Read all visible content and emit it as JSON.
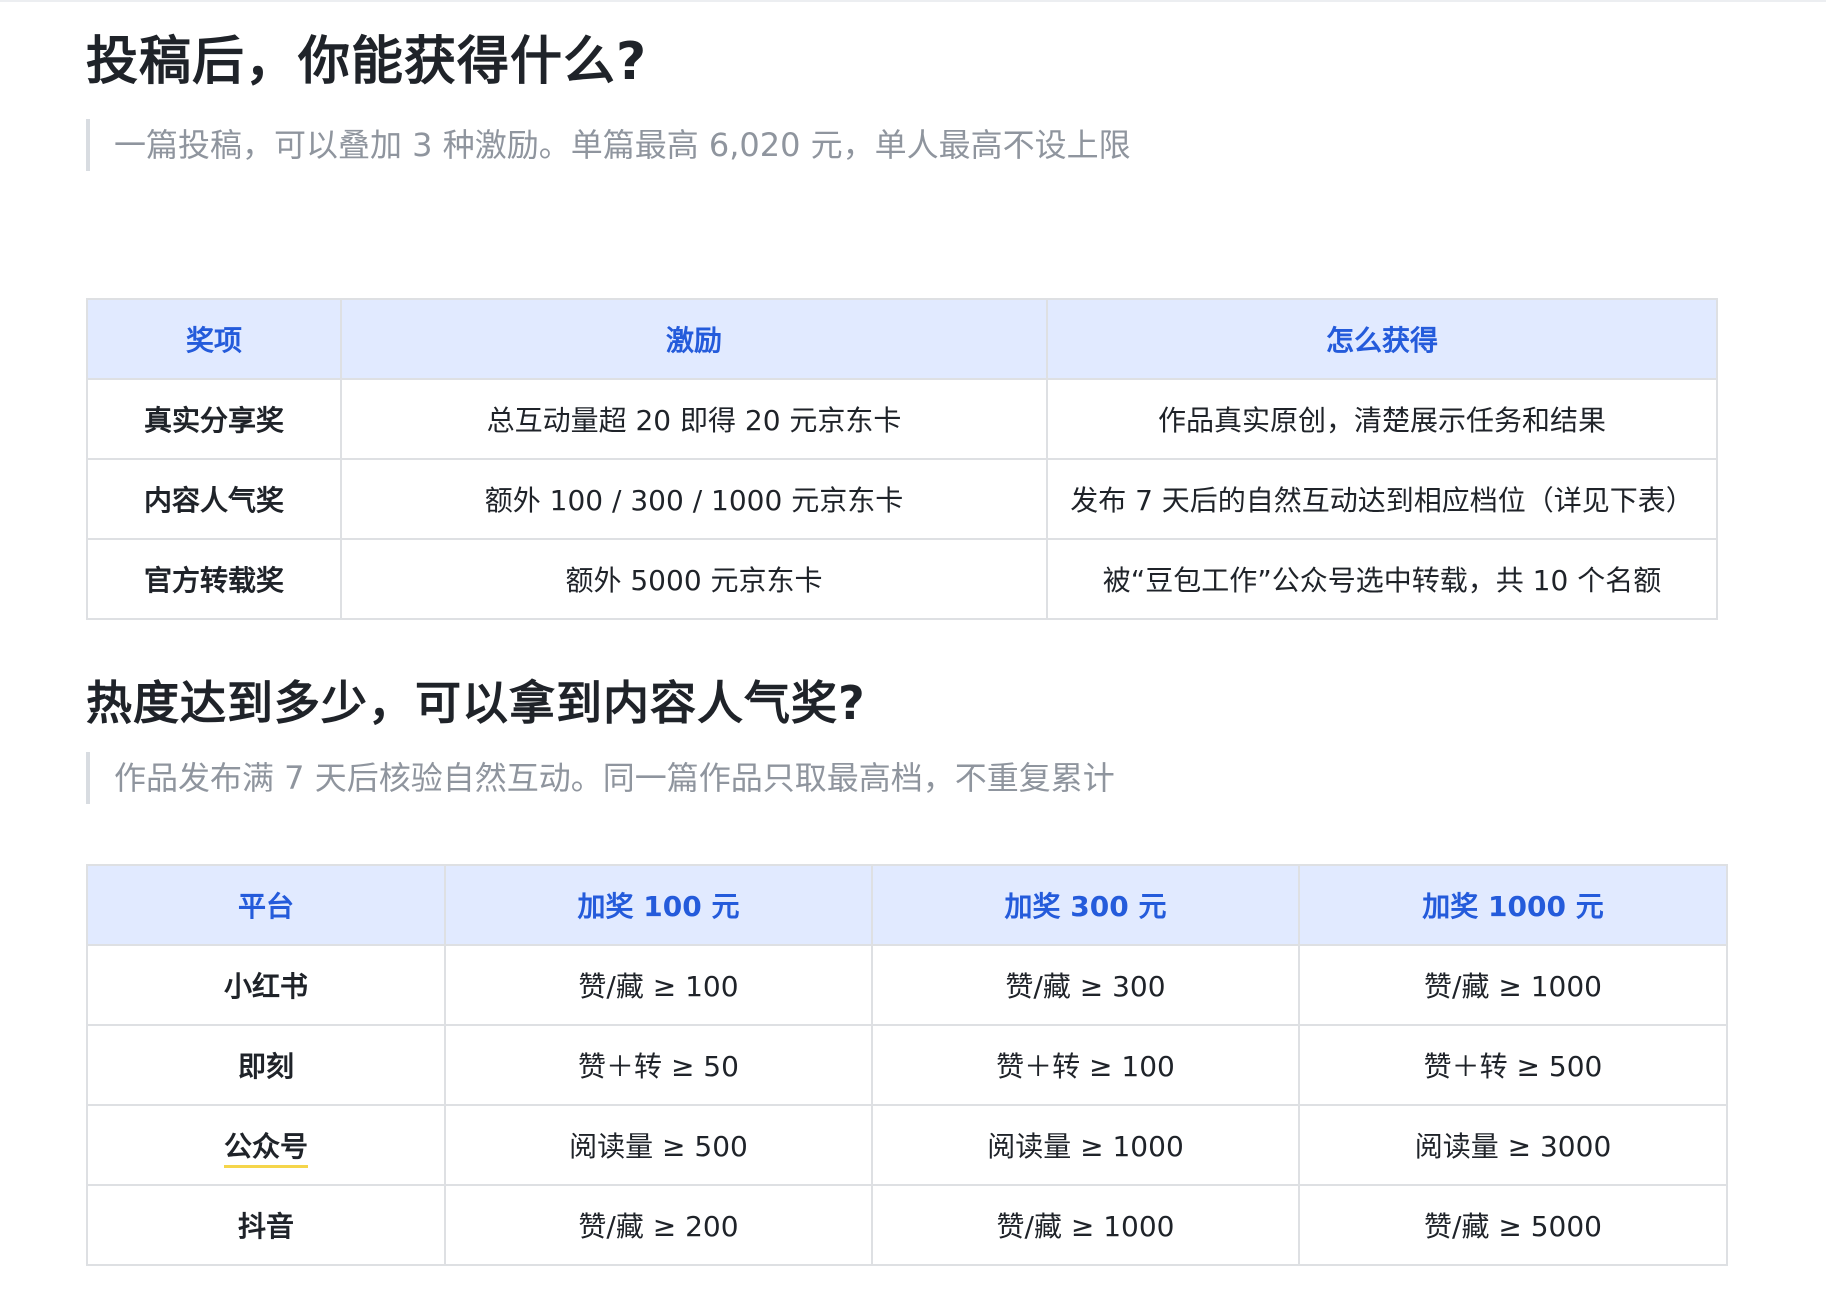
{
  "section1": {
    "title": "投稿后，你能获得什么?",
    "quote": "一篇投稿，可以叠加 3 种激励。单篇最高 6,020 元，单人最高不设上限",
    "table": {
      "headers": [
        "奖项",
        "激励",
        "怎么获得"
      ],
      "rows": [
        [
          "真实分享奖",
          "总互动量超 20 即得 20 元京东卡",
          "作品真实原创，清楚展示任务和结果"
        ],
        [
          "内容人气奖",
          "额外 100 / 300 / 1000 元京东卡",
          "发布 7 天后的自然互动达到相应档位（详见下表）"
        ],
        [
          "官方转载奖",
          "额外 5000 元京东卡",
          "被“豆包工作”公众号选中转载，共 10 个名额"
        ]
      ]
    }
  },
  "section2": {
    "title": "热度达到多少，可以拿到内容人气奖?",
    "quote": "作品发布满 7 天后核验自然互动。同一篇作品只取最高档，不重复累计",
    "table": {
      "headers": [
        "平台",
        "加奖 100 元",
        "加奖 300 元",
        "加奖 1000 元"
      ],
      "rows": [
        [
          "小红书",
          "赞/藏 ≥ 100",
          "赞/藏 ≥ 300",
          "赞/藏 ≥ 1000"
        ],
        [
          "即刻",
          "赞＋转 ≥ 50",
          "赞＋转 ≥ 100",
          "赞＋转 ≥ 500"
        ],
        [
          "公众号",
          "阅读量 ≥ 500",
          "阅读量 ≥ 1000",
          "阅读量 ≥ 3000"
        ],
        [
          "抖音",
          "赞/藏 ≥ 200",
          "赞/藏 ≥ 1000",
          "赞/藏 ≥ 5000"
        ]
      ]
    }
  },
  "colors": {
    "header_bg": "#e1eaff",
    "header_text": "#245bdb",
    "border": "#dee0e3",
    "quote_text": "#8f959e",
    "highlight_underline": "#f5d54a"
  }
}
